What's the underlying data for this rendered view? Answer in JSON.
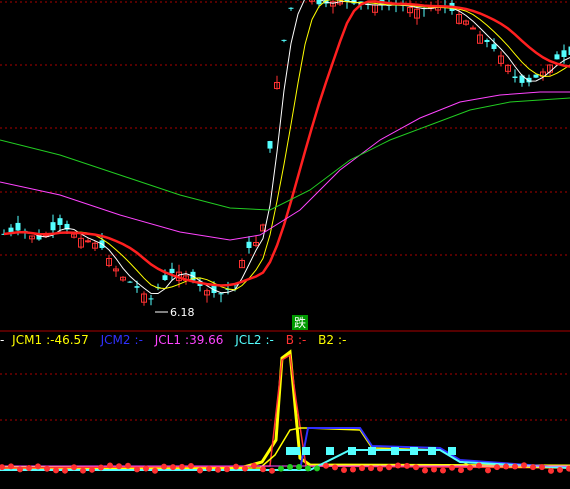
{
  "chart_data": [
    {
      "type": "candlestick",
      "title": "",
      "low_annotation": "6.18",
      "signal_label": "跌",
      "gridlines_horizontal": true,
      "colors": {
        "up": "#ff3232",
        "down": "#54ffff",
        "ma_white": "#ffffff",
        "ma_yellow": "#ffff00",
        "ma_red": "#ff2020",
        "ma_magenta": "#ff44ff",
        "ma_green": "#22cc22",
        "signal_bg": "#009900",
        "grid": "#aa0000"
      },
      "series": [
        {
          "name": "MA5",
          "color": "#ffffff"
        },
        {
          "name": "MA10",
          "color": "#ffff00"
        },
        {
          "name": "MA20",
          "color": "#ff2020"
        },
        {
          "name": "MA60",
          "color": "#ff44ff"
        },
        {
          "name": "MA120",
          "color": "#22cc22"
        }
      ]
    },
    {
      "type": "line",
      "legend": [
        {
          "name": "JCM1",
          "value": "-46.57",
          "color": "#ffff00"
        },
        {
          "name": "JCM2",
          "value": "-",
          "color": "#3030ff"
        },
        {
          "name": "JCL1",
          "value": "39.66",
          "color": "#ff44ff"
        },
        {
          "name": "JCL2",
          "value": "-",
          "color": "#54ffff"
        },
        {
          "name": "B",
          "value": "-",
          "color": "#ff3232"
        },
        {
          "name": "B2",
          "value": "-",
          "color": "#ffff00"
        }
      ],
      "legend_prefix": "-",
      "gridlines_horizontal": true
    }
  ]
}
